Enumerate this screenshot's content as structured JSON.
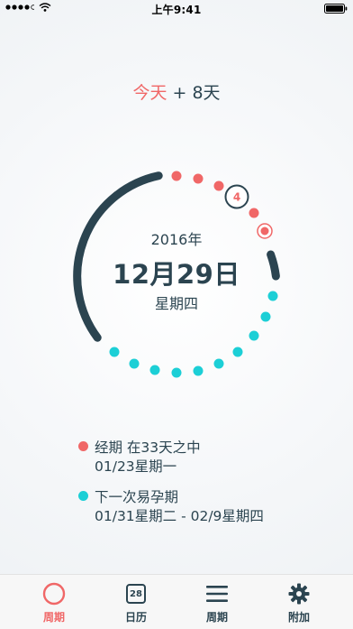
{
  "status_bar": {
    "time": "上午9:41"
  },
  "header": {
    "today": "今天",
    "offset": "+ 8天"
  },
  "cycle": {
    "year": "2016年",
    "date": "12月29日",
    "weekday": "星期四",
    "marker_number": "4"
  },
  "legend": [
    {
      "title": "经期 在33天之中",
      "subtitle": "01/23星期一",
      "color": "#f06767"
    },
    {
      "title": "下一次易孕期",
      "subtitle": "01/31星期二 - 02/9星期四",
      "color": "#1ccfd6"
    }
  ],
  "tabs": [
    {
      "label": "周期",
      "icon": "ring-icon",
      "active": true
    },
    {
      "label": "日历",
      "icon": "calendar-icon",
      "badge": "28",
      "active": false
    },
    {
      "label": "周期",
      "icon": "menu-icon",
      "active": false
    },
    {
      "label": "附加",
      "icon": "gear-icon",
      "active": false
    }
  ],
  "colors": {
    "accent_red": "#f06767",
    "accent_cyan": "#1ccfd6",
    "dark": "#2b4450"
  }
}
